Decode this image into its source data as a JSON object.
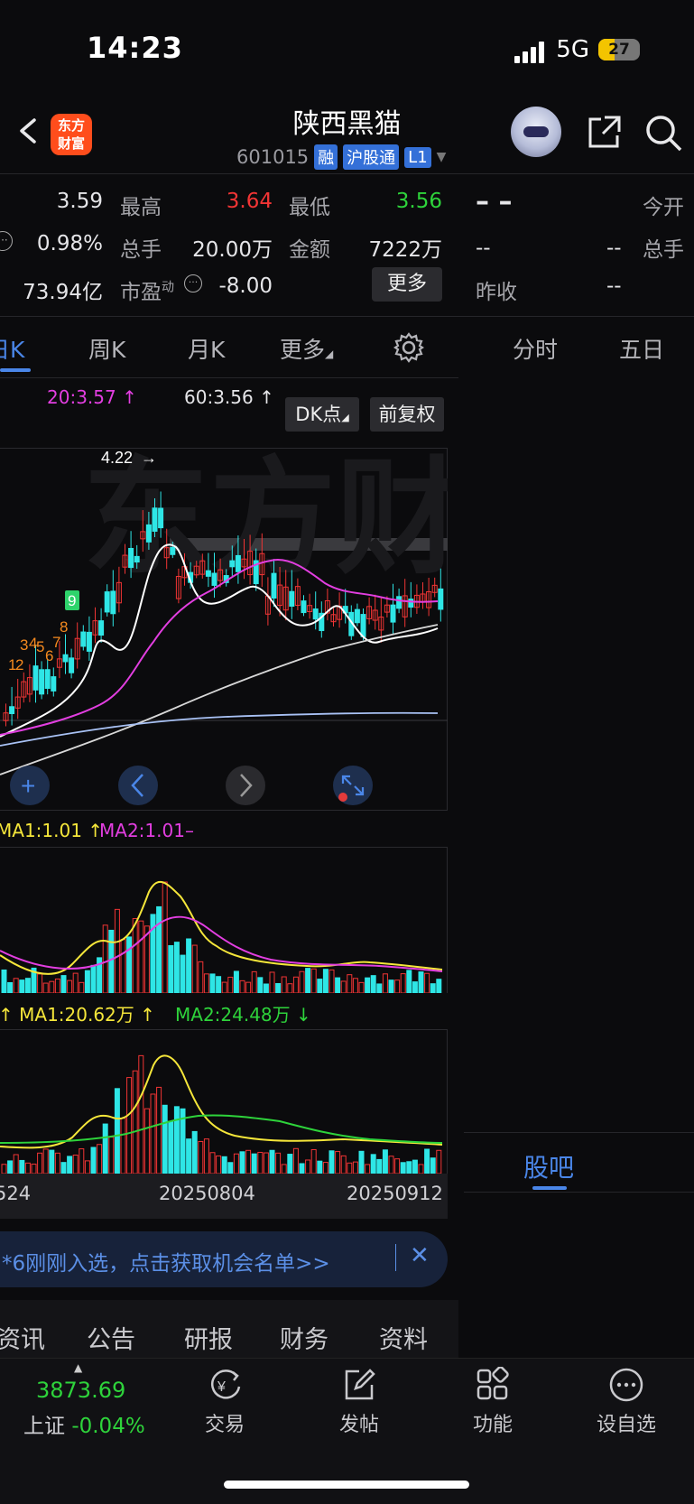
{
  "status": {
    "time": "14:23",
    "network": "5G",
    "battery": "27"
  },
  "header": {
    "logo": [
      "东方",
      "财富"
    ],
    "title": "陕西黑猫",
    "code": "601015",
    "tags": [
      "融",
      "沪股通",
      "L1"
    ]
  },
  "quote": {
    "row1": {
      "v0": "3.59",
      "high_label": "最高",
      "high": "3.64",
      "low_label": "最低",
      "low": "3.56",
      "r_val": "– –",
      "r_label": "今开"
    },
    "row2": {
      "v0": "0.98%",
      "vol_label": "总手",
      "vol": "20.00万",
      "amt_label": "金额",
      "amt": "7222万",
      "r_val1": "--",
      "r_val2": "--",
      "r_label": "总手"
    },
    "row3": {
      "v0": "73.94亿",
      "pe_label": "市盈",
      "pe_sup": "动",
      "pe": "-8.00",
      "more": "更多",
      "r_label": "昨收",
      "r_val": "--"
    }
  },
  "tabs": {
    "day": "日K",
    "week": "周K",
    "month": "月K",
    "more": "更多",
    "fenshi": "分时",
    "wuri": "五日"
  },
  "ma": {
    "ma20": "20:3.57",
    "ma60": "60:3.56",
    "dk": "DK点",
    "fq": "前复权"
  },
  "kline": {
    "high_label": "4.22",
    "seq": [
      "9",
      "8",
      "7",
      "6",
      "5",
      "4",
      "3",
      "2",
      "1"
    ]
  },
  "indicator1": {
    "ma1": "MA1:1.01",
    "ma2": "MA2:1.01"
  },
  "indicator2": {
    "ma1": "MA1:20.62万",
    "ma2": "MA2:24.48万"
  },
  "dates": [
    "524",
    "20250804",
    "20250912"
  ],
  "banner": {
    "text": "*6刚刚入选，点击获取机会名单>>"
  },
  "bottom_tabs": [
    "资讯",
    "公告",
    "研报",
    "财务",
    "资料"
  ],
  "guba": "股吧",
  "nav": {
    "index_value": "3873.69",
    "index_name": "上证",
    "index_change": "-0.04%",
    "items": [
      "交易",
      "发帖",
      "功能",
      "设自选"
    ]
  },
  "colors": {
    "up": "#f23535",
    "down": "#2ee6e6",
    "accent": "#4a86e8",
    "ma_white": "#ffffff",
    "ma_magenta": "#e23ee0",
    "ma_blue": "#a9c2f5",
    "ma_yellow": "#f5e63a",
    "ma_green": "#2ed33b"
  }
}
